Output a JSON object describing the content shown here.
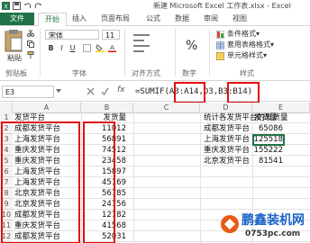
{
  "window": {
    "title": "新建 Microsoft Excel 工作表.xlsx - Excel"
  },
  "tabs": [
    "文件",
    "开始",
    "插入",
    "页面布局",
    "公式",
    "数据",
    "审阅",
    "视图"
  ],
  "ribbon": {
    "paste_label": "粘贴",
    "clipboard_label": "剪贴板",
    "font_name": "宋体",
    "font_size": "11",
    "font_group_label": "字体",
    "font_buttons": [
      "B",
      "I",
      "U"
    ],
    "align_group_label": "对齐方式",
    "number_format": "%",
    "number_group_label": "数字",
    "styles": [
      "条件格式▾",
      "套用表格格式▾",
      "单元格样式▾"
    ],
    "styles_group_label": "样式"
  },
  "formula_bar": {
    "name_box": "E3",
    "fx": "fx",
    "formula": "=SUMIF(A3:A14,D3,B3:B14)"
  },
  "columns": [
    "A",
    "B",
    "C",
    "D",
    "E"
  ],
  "rows": [
    {
      "n": "1",
      "a": "发货平台",
      "b": "发货量",
      "d": "统计各发货平台的发货量",
      "e": "发货量"
    },
    {
      "n": "2",
      "a": "成都发货平台",
      "b": "11012",
      "d": "成都发货平台",
      "e": "65086"
    },
    {
      "n": "3",
      "a": "上海发货平台",
      "b": "56891",
      "d": "上海发货平台",
      "e": "125518"
    },
    {
      "n": "4",
      "a": "重庆发货平台",
      "b": "74512",
      "d": "重庆发货平台",
      "e": "155222"
    },
    {
      "n": "5",
      "a": "重庆发货平台",
      "b": "23458",
      "d": "北京发货平台",
      "e": "81541"
    },
    {
      "n": "6",
      "a": "上海发货平台",
      "b": "15897",
      "d": "",
      "e": ""
    },
    {
      "n": "7",
      "a": "上海发货平台",
      "b": "45169",
      "d": "",
      "e": ""
    },
    {
      "n": "8",
      "a": "北京发货平台",
      "b": "56785",
      "d": "",
      "e": ""
    },
    {
      "n": "9",
      "a": "北京发货平台",
      "b": "24756",
      "d": "",
      "e": ""
    },
    {
      "n": "10",
      "a": "成都发货平台",
      "b": "12782",
      "d": "",
      "e": ""
    },
    {
      "n": "11",
      "a": "重庆发货平台",
      "b": "41568",
      "d": "",
      "e": ""
    },
    {
      "n": "12",
      "a": "成都发货平台",
      "b": "52031",
      "d": "",
      "e": ""
    },
    {
      "n": "13",
      "a": "重庆发货平台",
      "b": "15684",
      "d": "",
      "e": ""
    }
  ],
  "watermark": {
    "brand": "鹏鑫装机网",
    "url": "0753pc.com"
  },
  "colors": {
    "excel_green": "#217346",
    "highlight_red": "#e01010"
  }
}
